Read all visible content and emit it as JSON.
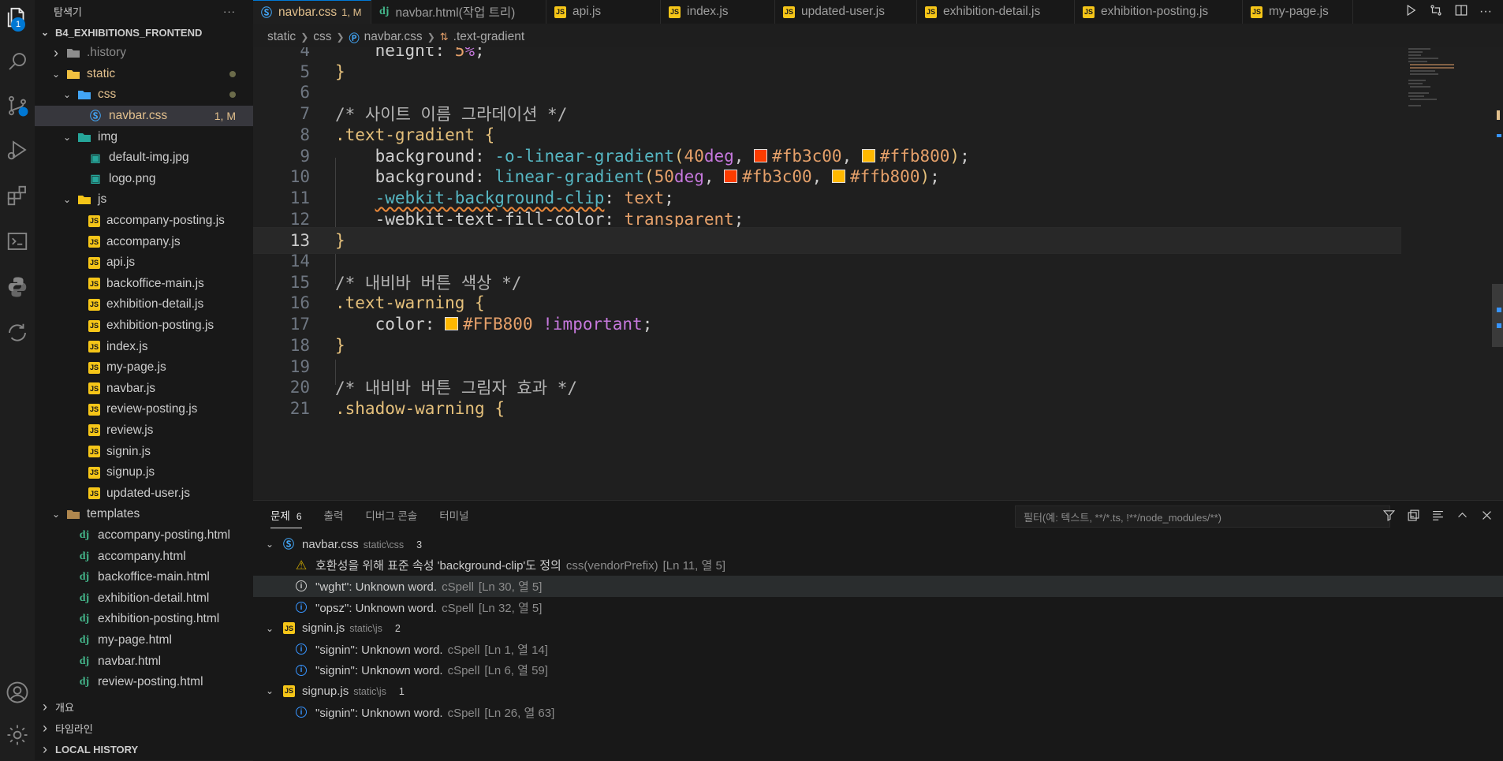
{
  "activity_bar": {
    "explorer_badge": "1",
    "icons": [
      "files-icon",
      "search-icon",
      "source-control-icon",
      "run-debug-icon",
      "extensions-icon",
      "terminal-icon",
      "python-icon",
      "remote-icon",
      "account-icon",
      "settings-gear-icon"
    ]
  },
  "sidebar": {
    "title": "탐색기",
    "more": "···",
    "project": "B4_EXHIBITIONS_FRONTEND",
    "tree": [
      {
        "label": ".history",
        "type": "folder",
        "depth": 1,
        "open": false
      },
      {
        "label": "static",
        "type": "folder",
        "depth": 1,
        "open": true,
        "status": "dot"
      },
      {
        "label": "css",
        "type": "folder",
        "depth": 2,
        "open": true,
        "status": "dot"
      },
      {
        "label": "navbar.css",
        "type": "css",
        "depth": 3,
        "status": "1, M",
        "selected": true
      },
      {
        "label": "img",
        "type": "folder",
        "depth": 2,
        "open": true
      },
      {
        "label": "default-img.jpg",
        "type": "img",
        "depth": 3
      },
      {
        "label": "logo.png",
        "type": "img",
        "depth": 3
      },
      {
        "label": "js",
        "type": "folder",
        "depth": 2,
        "open": true
      },
      {
        "label": "accompany-posting.js",
        "type": "js",
        "depth": 3
      },
      {
        "label": "accompany.js",
        "type": "js",
        "depth": 3
      },
      {
        "label": "api.js",
        "type": "js",
        "depth": 3
      },
      {
        "label": "backoffice-main.js",
        "type": "js",
        "depth": 3
      },
      {
        "label": "exhibition-detail.js",
        "type": "js",
        "depth": 3
      },
      {
        "label": "exhibition-posting.js",
        "type": "js",
        "depth": 3
      },
      {
        "label": "index.js",
        "type": "js",
        "depth": 3
      },
      {
        "label": "my-page.js",
        "type": "js",
        "depth": 3
      },
      {
        "label": "navbar.js",
        "type": "js",
        "depth": 3
      },
      {
        "label": "review-posting.js",
        "type": "js",
        "depth": 3
      },
      {
        "label": "review.js",
        "type": "js",
        "depth": 3
      },
      {
        "label": "signin.js",
        "type": "js",
        "depth": 3
      },
      {
        "label": "signup.js",
        "type": "js",
        "depth": 3
      },
      {
        "label": "updated-user.js",
        "type": "js",
        "depth": 3
      },
      {
        "label": "templates",
        "type": "folder",
        "depth": 1,
        "open": true
      },
      {
        "label": "accompany-posting.html",
        "type": "dj",
        "depth": 2
      },
      {
        "label": "accompany.html",
        "type": "dj",
        "depth": 2
      },
      {
        "label": "backoffice-main.html",
        "type": "dj",
        "depth": 2
      },
      {
        "label": "exhibition-detail.html",
        "type": "dj",
        "depth": 2
      },
      {
        "label": "exhibition-posting.html",
        "type": "dj",
        "depth": 2
      },
      {
        "label": "my-page.html",
        "type": "dj",
        "depth": 2
      },
      {
        "label": "navbar.html",
        "type": "dj",
        "depth": 2
      },
      {
        "label": "review-posting.html",
        "type": "dj",
        "depth": 2
      }
    ],
    "sections": [
      "개요",
      "타임라인",
      "LOCAL HISTORY"
    ]
  },
  "tabs": [
    {
      "label": "navbar.css",
      "status": "1, M",
      "icon": "css",
      "active": true,
      "width": 150
    },
    {
      "label": "navbar.html(작업 트리)",
      "icon": "dj",
      "width": 222
    },
    {
      "label": "api.js",
      "icon": "js",
      "width": 145
    },
    {
      "label": "index.js",
      "icon": "js",
      "width": 145
    },
    {
      "label": "updated-user.js",
      "icon": "js",
      "width": 180
    },
    {
      "label": "exhibition-detail.js",
      "icon": "js",
      "width": 200
    },
    {
      "label": "exhibition-posting.js",
      "icon": "js",
      "width": 213
    },
    {
      "label": "my-page.js",
      "icon": "js",
      "width": 140
    }
  ],
  "breadcrumb": [
    "static",
    "css",
    "navbar.css",
    ".text-gradient"
  ],
  "code_lines": [
    {
      "n": "4",
      "tokens": [
        [
          "    ",
          ""
        ],
        [
          "height",
          "c-prop"
        ],
        [
          ": ",
          "c-punc"
        ],
        [
          "5",
          "c-num"
        ],
        [
          "%",
          "c-unit"
        ],
        [
          ";",
          "c-punc"
        ]
      ]
    },
    {
      "n": "5",
      "tokens": [
        [
          "}",
          "c-brace"
        ]
      ]
    },
    {
      "n": "6",
      "tokens": []
    },
    {
      "n": "7",
      "tokens": [
        [
          "/* 사이트 이름 그라데이션 */",
          "c-comment"
        ]
      ]
    },
    {
      "n": "8",
      "tokens": [
        [
          ".text-gradient",
          "c-sel"
        ],
        [
          " ",
          ""
        ],
        [
          "{",
          "c-brace"
        ]
      ]
    },
    {
      "n": "9",
      "tokens": [
        [
          "    ",
          ""
        ],
        [
          "background",
          "c-prop"
        ],
        [
          ": ",
          "c-punc"
        ],
        [
          "-o-linear-gradient",
          "c-func"
        ],
        [
          "(",
          "c-brace"
        ],
        [
          "40",
          "c-num"
        ],
        [
          "deg",
          "c-unit"
        ],
        [
          ", ",
          "c-punc"
        ],
        [
          "#fb3c00",
          "c-val",
          "#fb3c00"
        ],
        [
          ", ",
          "c-punc"
        ],
        [
          "#ffb800",
          "c-val",
          "#ffb800"
        ],
        [
          ")",
          "c-brace"
        ],
        [
          ";",
          "c-punc"
        ]
      ]
    },
    {
      "n": "10",
      "tokens": [
        [
          "    ",
          ""
        ],
        [
          "background",
          "c-prop"
        ],
        [
          ": ",
          "c-punc"
        ],
        [
          "linear-gradient",
          "c-func"
        ],
        [
          "(",
          "c-brace"
        ],
        [
          "50",
          "c-num"
        ],
        [
          "deg",
          "c-unit"
        ],
        [
          ", ",
          "c-punc"
        ],
        [
          "#fb3c00",
          "c-val",
          "#fb3c00"
        ],
        [
          ", ",
          "c-punc"
        ],
        [
          "#ffb800",
          "c-val",
          "#ffb800"
        ],
        [
          ")",
          "c-brace"
        ],
        [
          ";",
          "c-punc"
        ]
      ]
    },
    {
      "n": "11",
      "tokens": [
        [
          "    ",
          ""
        ],
        [
          "-webkit-background-clip",
          "c-prefixprop"
        ],
        [
          ": ",
          "c-punc"
        ],
        [
          "text",
          "c-val"
        ],
        [
          ";",
          "c-punc"
        ]
      ]
    },
    {
      "n": "12",
      "tokens": [
        [
          "    ",
          ""
        ],
        [
          "-webkit-text-fill-color",
          "c-prop"
        ],
        [
          ": ",
          "c-punc"
        ],
        [
          "transparent",
          "c-val"
        ],
        [
          ";",
          "c-punc"
        ]
      ]
    },
    {
      "n": "13",
      "tokens": [
        [
          "}",
          "c-brace"
        ]
      ],
      "current": true
    },
    {
      "n": "14",
      "tokens": []
    },
    {
      "n": "15",
      "tokens": [
        [
          "/* 내비바 버튼 색상 */",
          "c-comment"
        ]
      ]
    },
    {
      "n": "16",
      "tokens": [
        [
          ".text-warning",
          "c-sel"
        ],
        [
          " ",
          ""
        ],
        [
          "{",
          "c-brace"
        ]
      ]
    },
    {
      "n": "17",
      "tokens": [
        [
          "    ",
          ""
        ],
        [
          "color",
          "c-prop"
        ],
        [
          ": ",
          "c-punc"
        ],
        [
          "#FFB800",
          "c-val",
          "#FFB800"
        ],
        [
          " ",
          ""
        ],
        [
          "!important",
          "c-imp"
        ],
        [
          ";",
          "c-punc"
        ]
      ]
    },
    {
      "n": "18",
      "tokens": [
        [
          "}",
          "c-brace"
        ]
      ]
    },
    {
      "n": "19",
      "tokens": []
    },
    {
      "n": "20",
      "tokens": [
        [
          "/* 내비바 버튼 그림자 효과 */",
          "c-comment"
        ]
      ]
    },
    {
      "n": "21",
      "tokens": [
        [
          ".shadow-warning",
          "c-sel"
        ],
        [
          " ",
          ""
        ],
        [
          "{",
          "c-brace"
        ]
      ]
    }
  ],
  "panel": {
    "tabs": [
      {
        "label": "문제",
        "count": "6",
        "active": true
      },
      {
        "label": "출력"
      },
      {
        "label": "디버그 콘솔"
      },
      {
        "label": "터미널"
      }
    ],
    "filter_placeholder": "필터(예: 텍스트, **/*.ts, !**/node_modules/**)",
    "problems": [
      {
        "kind": "file",
        "icon": "css",
        "name": "navbar.css",
        "path": "static\\css",
        "count": "3"
      },
      {
        "kind": "item",
        "sev": "warning",
        "msg": "호환성을 위해 표준 속성 'background-clip'도 정의",
        "src": "css(vendorPrefix)",
        "loc": "[Ln 11, 열 5]"
      },
      {
        "kind": "item",
        "sev": "info-white",
        "msg": "\"wght\": Unknown word.",
        "src": "cSpell",
        "loc": "[Ln 30, 열 5]",
        "highlight": true
      },
      {
        "kind": "item",
        "sev": "info",
        "msg": "\"opsz\": Unknown word.",
        "src": "cSpell",
        "loc": "[Ln 32, 열 5]"
      },
      {
        "kind": "file",
        "icon": "js",
        "name": "signin.js",
        "path": "static\\js",
        "count": "2"
      },
      {
        "kind": "item",
        "sev": "info",
        "msg": "\"signin\": Unknown word.",
        "src": "cSpell",
        "loc": "[Ln 1, 열 14]"
      },
      {
        "kind": "item",
        "sev": "info",
        "msg": "\"signin\": Unknown word.",
        "src": "cSpell",
        "loc": "[Ln 6, 열 59]"
      },
      {
        "kind": "file",
        "icon": "js",
        "name": "signup.js",
        "path": "static\\js",
        "count": "1"
      },
      {
        "kind": "item",
        "sev": "info",
        "msg": "\"signin\": Unknown word.",
        "src": "cSpell",
        "loc": "[Ln 26, 열 63]"
      }
    ]
  },
  "colors": {
    "accent": "#0078d4",
    "modified": "#e2c08d",
    "info": "#3794ff",
    "warning": "#cca700"
  }
}
